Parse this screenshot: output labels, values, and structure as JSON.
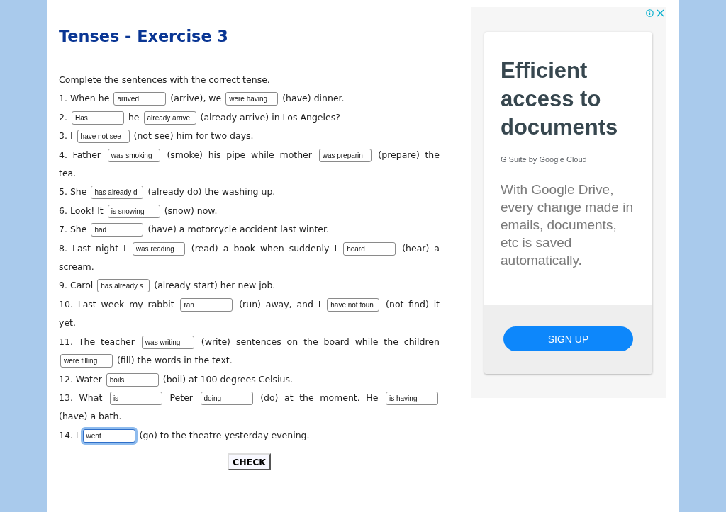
{
  "title": "Tenses - Exercise 3",
  "instructions": "Complete the sentences with the correct tense.",
  "sentences": [
    {
      "lines": [
        [
          {
            "kind": "text",
            "text": "1. When he"
          },
          {
            "kind": "blank",
            "value": "arrived",
            "focused": false
          },
          {
            "kind": "text",
            "text": "(arrive), we"
          },
          {
            "kind": "blank",
            "value": "were having",
            "focused": false
          },
          {
            "kind": "text",
            "text": "(have) dinner."
          }
        ]
      ]
    },
    {
      "lines": [
        [
          {
            "kind": "text",
            "text": "2."
          },
          {
            "kind": "blank",
            "value": "Has",
            "focused": false
          },
          {
            "kind": "text",
            "text": "he"
          },
          {
            "kind": "blank",
            "value": "already arrive",
            "focused": false
          },
          {
            "kind": "text",
            "text": "(already arrive) in Los Angeles?"
          }
        ]
      ]
    },
    {
      "lines": [
        [
          {
            "kind": "text",
            "text": "3. I"
          },
          {
            "kind": "blank",
            "value": "have not see",
            "focused": false
          },
          {
            "kind": "text",
            "text": "(not see) him for two days."
          }
        ]
      ]
    },
    {
      "lines": [
        [
          {
            "kind": "text",
            "text": "4. Father"
          },
          {
            "kind": "blank",
            "value": "was smoking",
            "focused": false
          },
          {
            "kind": "text",
            "text": "(smoke) his pipe while mother"
          },
          {
            "kind": "blank",
            "value": "was preparin",
            "focused": false
          },
          {
            "kind": "text",
            "text": "(prepare) the"
          }
        ],
        [
          {
            "kind": "text",
            "text": "tea."
          }
        ]
      ]
    },
    {
      "lines": [
        [
          {
            "kind": "text",
            "text": "5. She"
          },
          {
            "kind": "blank",
            "value": "has already d",
            "focused": false
          },
          {
            "kind": "text",
            "text": "(already do) the washing up."
          }
        ]
      ]
    },
    {
      "lines": [
        [
          {
            "kind": "text",
            "text": "6. Look! It"
          },
          {
            "kind": "blank",
            "value": "is snowing",
            "focused": false
          },
          {
            "kind": "text",
            "text": "(snow) now."
          }
        ]
      ]
    },
    {
      "lines": [
        [
          {
            "kind": "text",
            "text": "7. She"
          },
          {
            "kind": "blank",
            "value": "had",
            "focused": false
          },
          {
            "kind": "text",
            "text": "(have) a motorcycle accident last winter."
          }
        ]
      ]
    },
    {
      "lines": [
        [
          {
            "kind": "text",
            "text": "8. Last night I"
          },
          {
            "kind": "blank",
            "value": "was reading",
            "focused": false
          },
          {
            "kind": "text",
            "text": "(read) a book when suddenly I"
          },
          {
            "kind": "blank",
            "value": "heard",
            "focused": false
          },
          {
            "kind": "text",
            "text": "(hear) a"
          }
        ],
        [
          {
            "kind": "text",
            "text": "scream."
          }
        ]
      ]
    },
    {
      "lines": [
        [
          {
            "kind": "text",
            "text": "9. Carol"
          },
          {
            "kind": "blank",
            "value": "has already s",
            "focused": false
          },
          {
            "kind": "text",
            "text": "(already start) her new job."
          }
        ]
      ]
    },
    {
      "lines": [
        [
          {
            "kind": "text",
            "text": "10. Last week my rabbit"
          },
          {
            "kind": "blank",
            "value": "ran",
            "focused": false
          },
          {
            "kind": "text",
            "text": "(run) away, and I"
          },
          {
            "kind": "blank",
            "value": "have not foun",
            "focused": false
          },
          {
            "kind": "text",
            "text": "(not find) it"
          }
        ],
        [
          {
            "kind": "text",
            "text": "yet."
          }
        ]
      ]
    },
    {
      "lines": [
        [
          {
            "kind": "text",
            "text": "11. The teacher"
          },
          {
            "kind": "blank",
            "value": "was writing",
            "focused": false
          },
          {
            "kind": "text",
            "text": "(write) sentences on the board while the children"
          }
        ],
        [
          {
            "kind": "blank",
            "value": "were filling",
            "focused": false
          },
          {
            "kind": "text",
            "text": "(fill) the words in the text."
          }
        ]
      ]
    },
    {
      "lines": [
        [
          {
            "kind": "text",
            "text": "12. Water"
          },
          {
            "kind": "blank",
            "value": "boils",
            "focused": false
          },
          {
            "kind": "text",
            "text": "(boil) at 100 degrees Celsius."
          }
        ]
      ]
    },
    {
      "lines": [
        [
          {
            "kind": "text",
            "text": "13. What"
          },
          {
            "kind": "blank",
            "value": "is",
            "focused": false
          },
          {
            "kind": "text",
            "text": "Peter"
          },
          {
            "kind": "blank",
            "value": "doing",
            "focused": false
          },
          {
            "kind": "text",
            "text": "(do) at the moment. He"
          },
          {
            "kind": "blank",
            "value": "is having",
            "focused": false
          }
        ],
        [
          {
            "kind": "text",
            "text": "(have) a bath."
          }
        ]
      ]
    },
    {
      "lines": [
        [
          {
            "kind": "text",
            "text": "14. I"
          },
          {
            "kind": "blank",
            "value": "went",
            "focused": true
          },
          {
            "kind": "text",
            "text": "(go) to the theatre yesterday evening."
          }
        ]
      ]
    }
  ],
  "check_button": "CHECK",
  "ad": {
    "headline": "Efficient access to documents",
    "advertiser": "G Suite by Google Cloud",
    "body": "With Google Drive, every change made in emails, documents, etc is saved automatically.",
    "button": "SIGN UP"
  }
}
